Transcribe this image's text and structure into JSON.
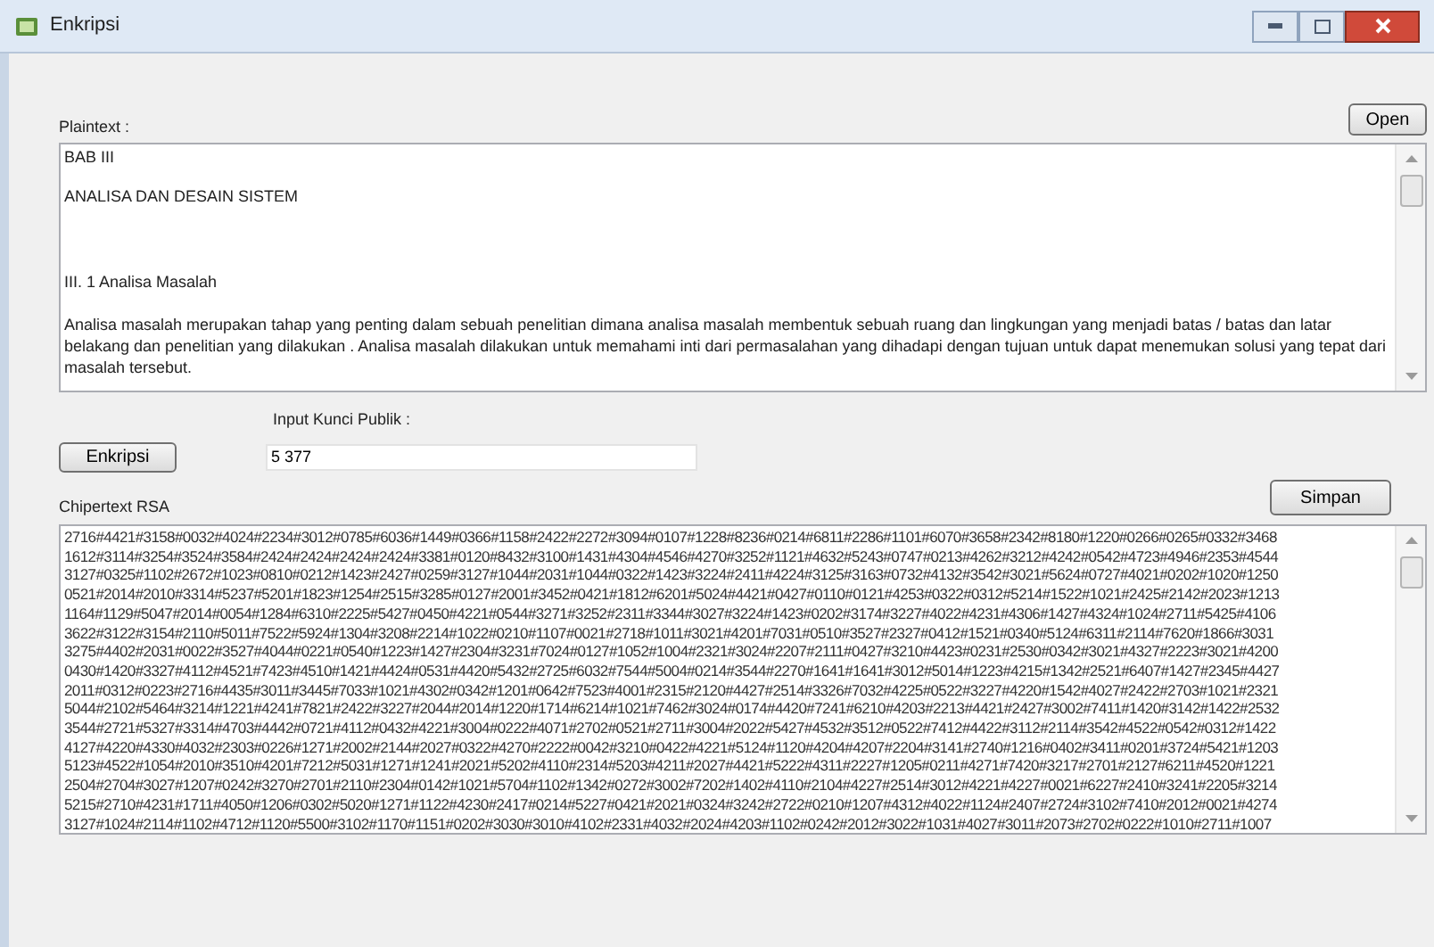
{
  "window": {
    "title": "Enkripsi"
  },
  "plaintext": {
    "label": "Plaintext :",
    "open_button": "Open",
    "lines": [
      {
        "kind": "title",
        "text": "BAB III"
      },
      {
        "kind": "subtitle",
        "text": "ANALISA DAN DESAIN SISTEM"
      },
      {
        "kind": "section",
        "text": "III. 1   Analisa Masalah"
      },
      {
        "kind": "paragraph",
        "text": "Analisa masalah merupakan tahap yang penting dalam sebuah penelitian dimana analisa masalah membentuk sebuah ruang dan lingkungan yang menjadi batas / batas dan latar belakang dan penelitian yang dilakukan . Analisa masalah dilakukan untuk memahami inti dari permasalahan yang dihadapi dengan tujuan untuk dapat menemukan solusi yang tepat dari masalah tersebut."
      }
    ]
  },
  "key": {
    "label": "Input Kunci Publik :",
    "encrypt_button": "Enkripsi",
    "value": "5 377"
  },
  "ciphertext": {
    "label": "Chipertext RSA",
    "save_button": "Simpan",
    "lines": [
      "2716#4421#3158#0032#4024#2234#3012#0785#6036#1449#0366#1158#2422#2272#3094#0107#1228#8236#0214#6811#2286#1101#6070#3658#2342#8180#1220#0266#0265#0332#3468",
      "1612#3114#3254#3524#3584#2424#2424#2424#2424#3381#0120#8432#3100#1431#4304#4546#4270#3252#1121#4632#5243#0747#0213#4262#3212#4242#0542#4723#4946#2353#4544",
      "3127#0325#1102#2672#1023#0810#0212#1423#2427#0259#3127#1044#2031#1044#0322#1423#3224#2411#4224#3125#3163#0732#4132#3542#3021#5624#0727#4021#0202#1020#1250",
      "0521#2014#2010#3314#5237#5201#1823#1254#2515#3285#0127#2001#3452#0421#1812#6201#5024#4421#0427#0110#0121#4253#0322#0312#5214#1522#1021#2425#2142#2023#1213",
      "1164#1129#5047#2014#0054#1284#6310#2225#5427#0450#4221#0544#3271#3252#2311#3344#3027#3224#1423#0202#3174#3227#4022#4231#4306#1427#4324#1024#2711#5425#4106",
      "3622#3122#3154#2110#5011#7522#5924#1304#3208#2214#1022#0210#1107#0021#2718#1011#3021#4201#7031#0510#3527#2327#0412#1521#0340#5124#6311#2114#7620#1866#3031",
      "3275#4402#2031#0022#3527#4044#0221#0540#1223#1427#2304#3231#7024#0127#1052#1004#2321#3024#2207#2111#0427#3210#4423#0231#2530#0342#3021#4327#2223#3021#4200",
      "0430#1420#3327#4112#4521#7423#4510#1421#4424#0531#4420#5432#2725#6032#7544#5004#0214#3544#2270#1641#1641#3012#5014#1223#4215#1342#2521#6407#1427#2345#4427",
      "2011#0312#0223#2716#4435#3011#3445#7033#1021#4302#0342#1201#0642#7523#4001#2315#2120#4427#2514#3326#7032#4225#0522#3227#4220#1542#4027#2422#2703#1021#2321",
      "5044#2102#5464#3214#1221#4241#7821#2422#3227#2044#2014#1220#1714#6214#1021#7462#3024#0174#4420#7241#6210#4203#2213#4421#2427#3002#7411#1420#3142#1422#2532",
      "3544#2721#5327#3314#4703#4442#0721#4112#0432#4221#3004#0222#4071#2702#0521#2711#3004#2022#5427#4532#3512#0522#7412#4422#3112#2114#3542#4522#0542#0312#1422",
      "4127#4220#4330#4032#2303#0226#1271#2002#2144#2027#0322#4270#2222#0042#3210#0422#4221#5124#1120#4204#4207#2204#3141#2740#1216#0402#3411#0201#3724#5421#1203",
      "5123#4522#1054#2010#3510#4201#7212#5031#1271#1241#2021#5202#4110#2314#5203#4211#2027#4421#5222#4311#2227#1205#0211#4271#7420#3217#2701#2127#6211#4520#1221",
      "2504#2704#3027#1207#0242#3270#2701#2110#2304#0142#1021#5704#1102#1342#0272#3002#7202#1402#4110#2104#4227#2514#3012#4221#4227#0021#6227#2410#3241#2205#3214",
      "5215#2710#4231#1711#4050#1206#0302#5020#1271#1122#4230#2417#0214#5227#0421#2021#0324#3242#2722#0210#1207#4312#4022#1124#2407#2724#3102#7410#2012#0021#4274",
      "3127#1024#2114#1102#4712#1120#5500#3102#1170#1151#0202#3030#3010#4102#2331#4032#2024#4203#1102#0242#2012#3022#1031#4027#3011#2073#2702#0222#1010#2711#1007"
    ]
  }
}
